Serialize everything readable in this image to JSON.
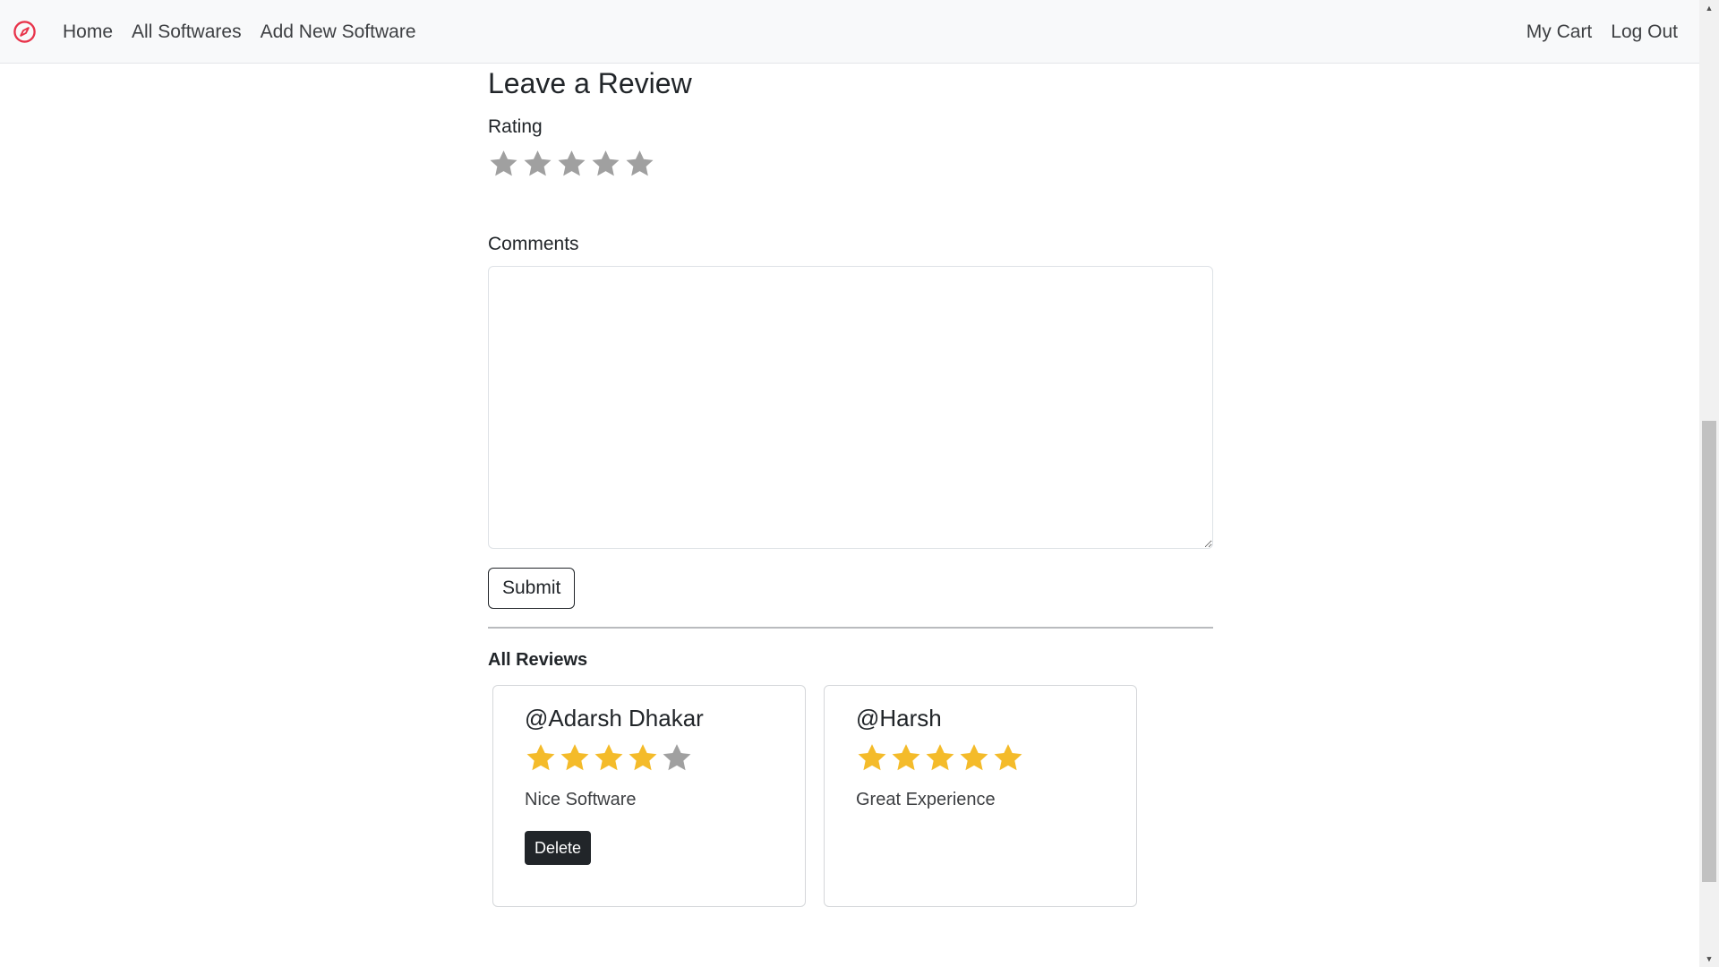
{
  "navbar": {
    "brand_icon": "compass-icon",
    "brand_color": "#e8334a",
    "left_links": [
      "Home",
      "All Softwares",
      "Add New Software"
    ],
    "right_links": [
      "My Cart",
      "Log Out"
    ]
  },
  "review_form": {
    "title": "Leave a Review",
    "rating_label": "Rating",
    "rating_value": 0,
    "rating_max": 5,
    "comments_label": "Comments",
    "comments_value": "",
    "submit_label": "Submit"
  },
  "reviews_section": {
    "heading": "All Reviews",
    "reviews": [
      {
        "user": "@Adarsh Dhakar",
        "rating": 4,
        "max": 5,
        "text": "Nice Software",
        "delete_label": "Delete",
        "has_delete": true
      },
      {
        "user": "@Harsh",
        "rating": 5,
        "max": 5,
        "text": "Great Experience",
        "has_delete": false
      }
    ]
  },
  "colors": {
    "star_filled": "#f4bb2a",
    "star_empty": "#a0a0a0",
    "delete_bg": "#212529"
  }
}
